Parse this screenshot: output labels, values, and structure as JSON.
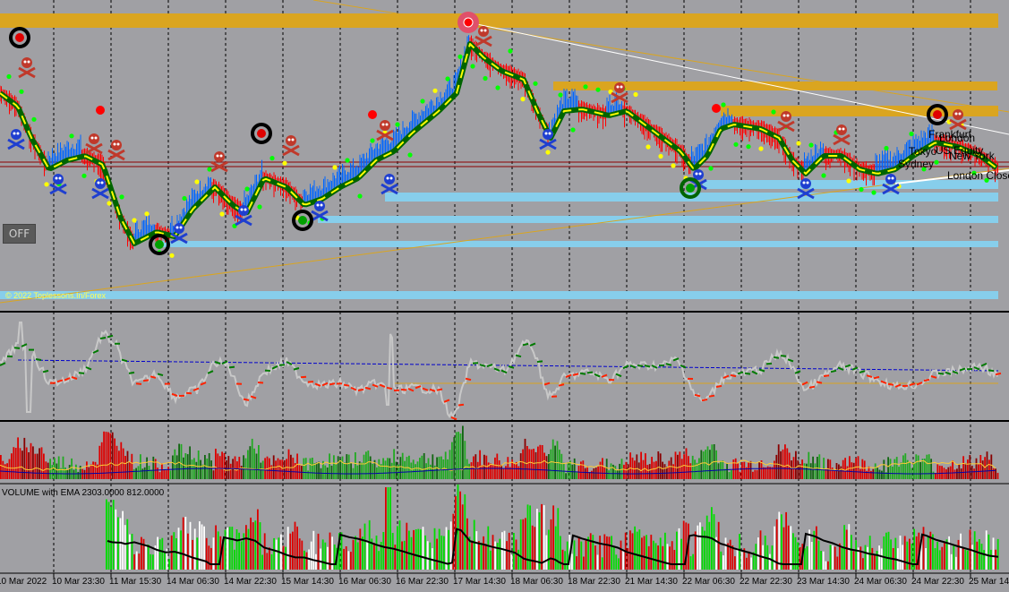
{
  "off_label": "OFF",
  "copyright": "© 2022 Toplessons.In/Forex",
  "volume_label": "VOLUME with EMA 2303.0000 812.0000",
  "session_labels": [
    "Frankfurt",
    "London",
    "Tokyo",
    "US Equity",
    "New York",
    "Sydney",
    "London Close"
  ],
  "colors": {
    "background": "#a0a0a4",
    "resistance_zone": "#daa520",
    "support_zone": "#87ceeb",
    "up_bar": "#0066ff",
    "down_bar": "#ff0000",
    "ma_outer": "#006400",
    "ma_inner": "#ffff00",
    "volume_up": "#00dd00",
    "volume_down": "#dd0000",
    "volume_neutral": "#ffffff",
    "ema": "#000000"
  },
  "chart_data": [
    {
      "type": "line",
      "panel": "price",
      "x": [
        "10 Mar 2022",
        "10 Mar 23:30",
        "11 Mar 15:30",
        "14 Mar 06:30",
        "14 Mar 22:30",
        "15 Mar 14:30",
        "16 Mar 06:30",
        "16 Mar 22:30",
        "17 Mar 14:30",
        "18 Mar 06:30",
        "18 Mar 22:30",
        "21 Mar 14:30",
        "22 Mar 06:30",
        "22 Mar 22:30",
        "23 Mar 14:30",
        "24 Mar 06:30",
        "24 Mar 22:30",
        "25 Mar 14:"
      ],
      "resistance_zones": 3,
      "support_zones": 6,
      "signal_markers": [
        "sell",
        "buy",
        "buy",
        "sell",
        "buy",
        "sell",
        "buy",
        "sell"
      ]
    },
    {
      "type": "line",
      "panel": "oscillator",
      "reference_line": "dashed-blue"
    },
    {
      "type": "bar",
      "panel": "histogram",
      "series": [
        {
          "name": "up"
        },
        {
          "name": "down"
        }
      ]
    },
    {
      "type": "bar",
      "panel": "volume",
      "title": "VOLUME with EMA 2303.0000 812.0000",
      "ema_period": 2303,
      "ema_value": 812
    }
  ]
}
